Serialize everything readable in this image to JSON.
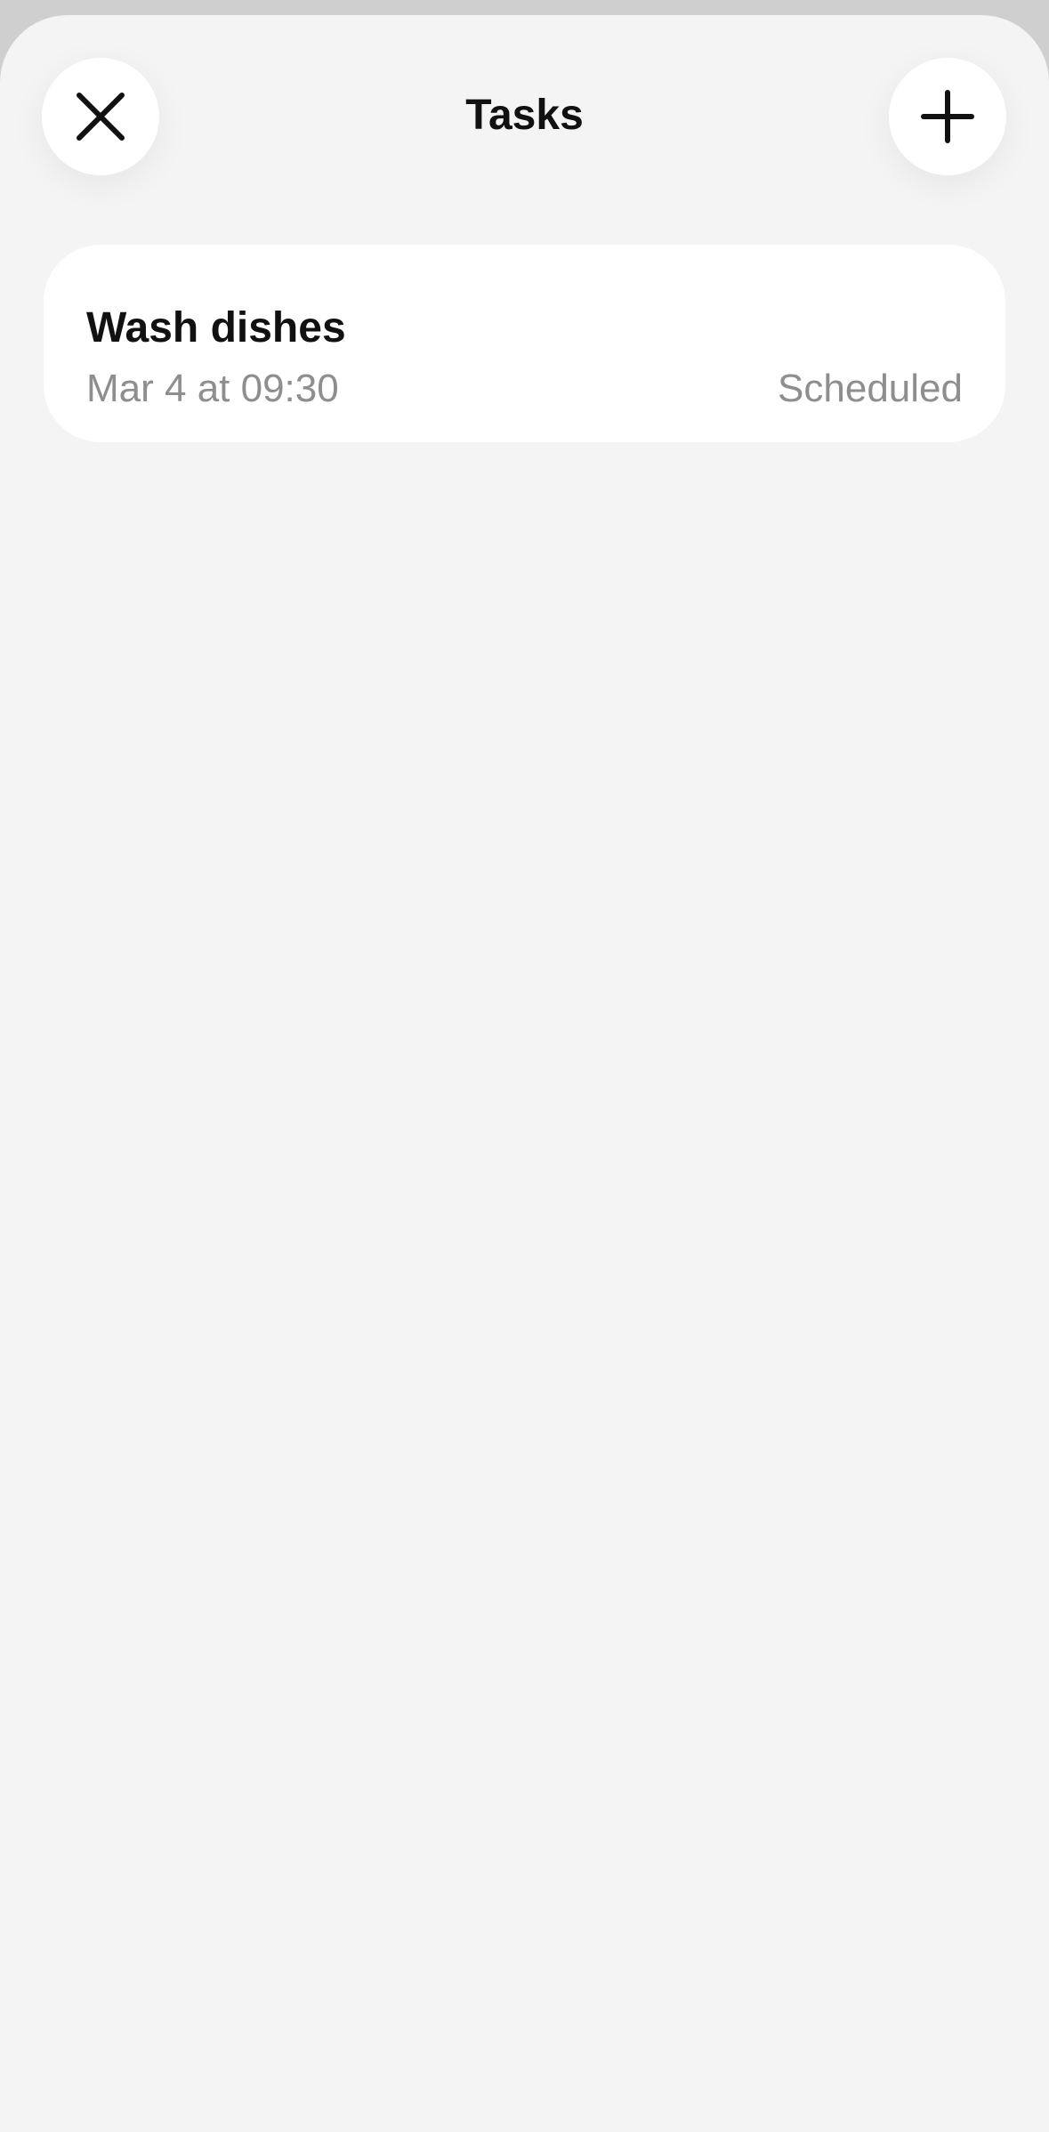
{
  "header": {
    "title": "Tasks",
    "close_icon": "close-icon",
    "add_icon": "plus-icon"
  },
  "tasks": [
    {
      "title": "Wash dishes",
      "datetime": "Mar 4 at 09:30",
      "status": "Scheduled"
    }
  ],
  "colors": {
    "background": "#f4f4f4",
    "card": "#ffffff",
    "text_primary": "#111111",
    "text_secondary": "#8e8e8e"
  }
}
